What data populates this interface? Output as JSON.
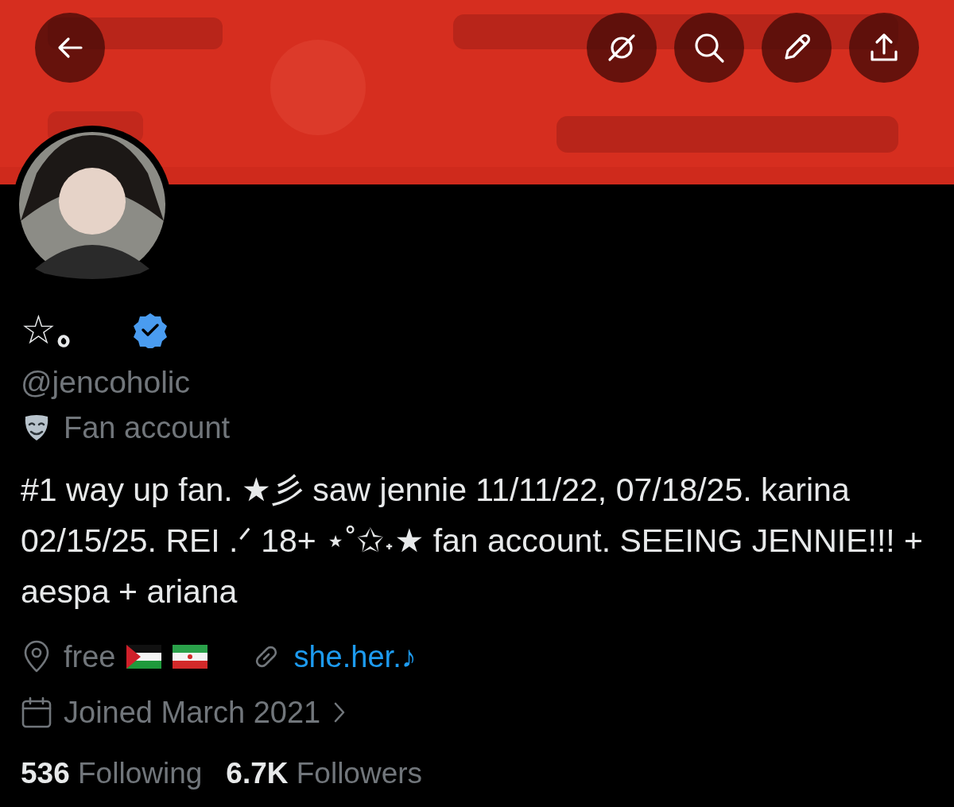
{
  "profile": {
    "display_name": "☆｡",
    "verified": true,
    "handle": "@jencoholic",
    "category": "Fan account",
    "bio": "#1 way up fan. ★彡 saw jennie 11/11/22, 07/18/25. karina 02/15/25. REI .ᐟ 18+ ⋆˚✩˖★ fan account. SEEING JENNIE!!! + aespa + ariana",
    "location": "free",
    "website": "she.her.♪",
    "joined": "Joined March 2021",
    "stats": [
      {
        "count": "536",
        "label": "Following"
      },
      {
        "count": "6.7K",
        "label": "Followers"
      }
    ]
  }
}
